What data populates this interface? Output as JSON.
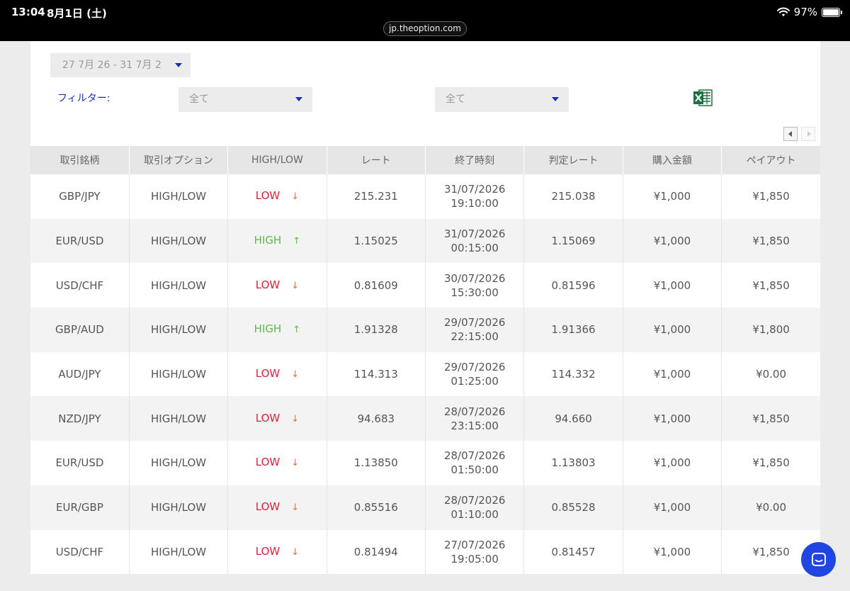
{
  "status_bar": {
    "time": "13:04",
    "date": "8月1日 (土)",
    "battery": "97%",
    "url": "jp.theoption.com"
  },
  "controls": {
    "date_range": "27 7月 26  -  31 7月 2",
    "filter_label": "フィルター:",
    "filter1_value": "全て",
    "filter2_value": "全て",
    "excel_icon": "excel-export-icon"
  },
  "table": {
    "headers": [
      "取引銘柄",
      "取引オプション",
      "HIGH/LOW",
      "レート",
      "終了時刻",
      "判定レート",
      "購入金額",
      "ペイアウト"
    ],
    "rows": [
      {
        "symbol": "GBP/JPY",
        "option": "HIGH/LOW",
        "direction": "LOW",
        "rate": "215.231",
        "end_date": "31/07/2026",
        "end_time": "19:10:00",
        "judge_rate": "215.038",
        "amount": "¥1,000",
        "payout": "¥1,850"
      },
      {
        "symbol": "EUR/USD",
        "option": "HIGH/LOW",
        "direction": "HIGH",
        "rate": "1.15025",
        "end_date": "31/07/2026",
        "end_time": "00:15:00",
        "judge_rate": "1.15069",
        "amount": "¥1,000",
        "payout": "¥1,850"
      },
      {
        "symbol": "USD/CHF",
        "option": "HIGH/LOW",
        "direction": "LOW",
        "rate": "0.81609",
        "end_date": "30/07/2026",
        "end_time": "15:30:00",
        "judge_rate": "0.81596",
        "amount": "¥1,000",
        "payout": "¥1,850"
      },
      {
        "symbol": "GBP/AUD",
        "option": "HIGH/LOW",
        "direction": "HIGH",
        "rate": "1.91328",
        "end_date": "29/07/2026",
        "end_time": "22:15:00",
        "judge_rate": "1.91366",
        "amount": "¥1,000",
        "payout": "¥1,800"
      },
      {
        "symbol": "AUD/JPY",
        "option": "HIGH/LOW",
        "direction": "LOW",
        "rate": "114.313",
        "end_date": "29/07/2026",
        "end_time": "01:25:00",
        "judge_rate": "114.332",
        "amount": "¥1,000",
        "payout": "¥0.00"
      },
      {
        "symbol": "NZD/JPY",
        "option": "HIGH/LOW",
        "direction": "LOW",
        "rate": "94.683",
        "end_date": "28/07/2026",
        "end_time": "23:15:00",
        "judge_rate": "94.660",
        "amount": "¥1,000",
        "payout": "¥1,850"
      },
      {
        "symbol": "EUR/USD",
        "option": "HIGH/LOW",
        "direction": "LOW",
        "rate": "1.13850",
        "end_date": "28/07/2026",
        "end_time": "01:50:00",
        "judge_rate": "1.13803",
        "amount": "¥1,000",
        "payout": "¥1,850"
      },
      {
        "symbol": "EUR/GBP",
        "option": "HIGH/LOW",
        "direction": "LOW",
        "rate": "0.85516",
        "end_date": "28/07/2026",
        "end_time": "01:10:00",
        "judge_rate": "0.85528",
        "amount": "¥1,000",
        "payout": "¥0.00"
      },
      {
        "symbol": "USD/CHF",
        "option": "HIGH/LOW",
        "direction": "LOW",
        "rate": "0.81494",
        "end_date": "27/07/2026",
        "end_time": "19:05:00",
        "judge_rate": "0.81457",
        "amount": "¥1,000",
        "payout": "¥1,850"
      }
    ]
  },
  "colors": {
    "accent": "#1a2fb3",
    "low": "#d0243f",
    "high": "#5bb94a",
    "chat": "#1f46e0"
  },
  "chat_button_icon": "chat-icon"
}
